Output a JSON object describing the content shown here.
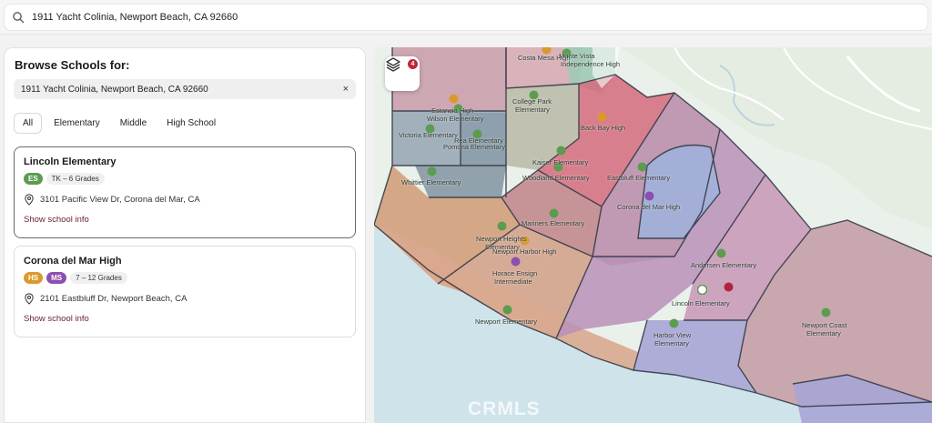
{
  "search": {
    "value": "1911 Yacht Colinia, Newport Beach, CA 92660"
  },
  "panel": {
    "title": "Browse Schools for:",
    "address_chip": "1911 Yacht Colinia, Newport Beach, CA 92660",
    "clear_label": "×",
    "filters": [
      "All",
      "Elementary",
      "Middle",
      "High School"
    ],
    "active_filter": "All"
  },
  "schools": [
    {
      "name": "Lincoln Elementary",
      "badges": [
        {
          "text": "ES",
          "color": "#5b9c4f"
        }
      ],
      "grades": "TK – 6 Grades",
      "address": "3101 Pacific View Dr, Corona del Mar, CA",
      "link": "Show school info"
    },
    {
      "name": "Corona del Mar High",
      "badges": [
        {
          "text": "HS",
          "color": "#d99a2b"
        },
        {
          "text": "MS",
          "color": "#8d4fb0"
        }
      ],
      "grades": "7 – 12 Grades",
      "address": "2101 Eastbluff Dr, Newport Beach, CA",
      "link": "Show school info"
    }
  ],
  "map": {
    "layers_count": "4",
    "watermark": "CRMLS",
    "labels": {
      "costa_mesa": "Costa Mesa High",
      "monte_vista": "Monte Vista",
      "independence": "Independence High",
      "estancia": "Estancia High",
      "wilson": "Wilson Elementary",
      "college_park": "College Park",
      "college_park2": "Elementary",
      "victoria": "Victoria Elementary",
      "rea": "Rea Elementary",
      "pomona": "Pomona Elementary",
      "back_bay": "Back Bay High",
      "kaiser": "Kaiser Elementary",
      "woodland": "Woodland Elementary",
      "whittier": "Whittier Elementary",
      "eastbluff": "Eastbluff Elementary",
      "cdm_high": "Corona del Mar High",
      "mariners": "Mariners Elementary",
      "newport_heights": "Newport Heights",
      "newport_heights2": "Elementary",
      "newport_harbor": "Newport Harbor High",
      "ensign": "Horace Ensign",
      "ensign2": "Intermediate",
      "andersen": "Andersen Elementary",
      "lincoln": "Lincoln Elementary",
      "newport_elem": "Newport Elementary",
      "harbor_view": "Harbor View",
      "harbor_view2": "Elementary",
      "newport_coast": "Newport Coast",
      "newport_coast2": "Elementary"
    }
  },
  "colors": {
    "elementary": "#5b9c4f",
    "high": "#d99a2b",
    "middle": "#8d4fb0",
    "selected_marker": "#b0243a",
    "link": "#6b1f2a"
  }
}
